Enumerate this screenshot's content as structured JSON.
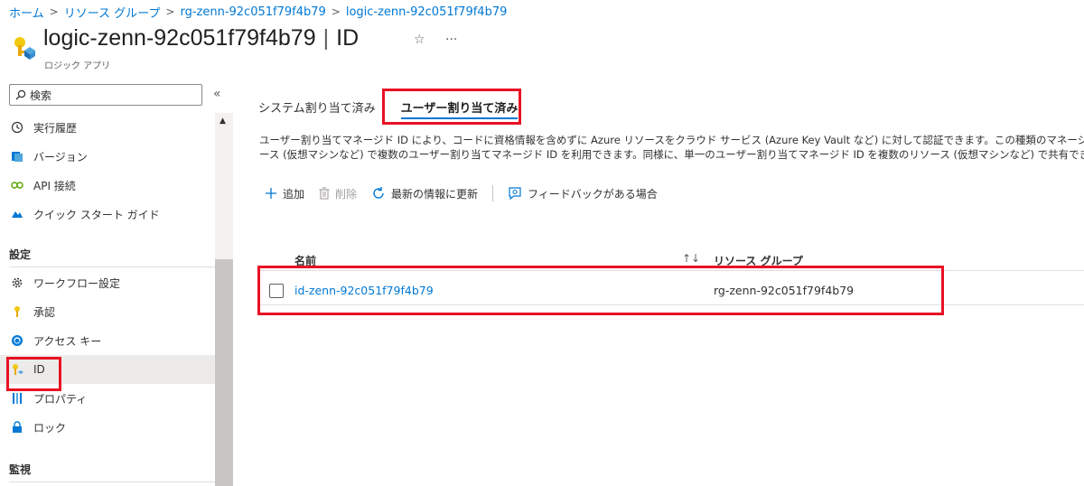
{
  "breadcrumb": [
    {
      "label": "ホーム"
    },
    {
      "label": "リソース グループ"
    },
    {
      "label": "rg-zenn-92c051f79f4b79"
    },
    {
      "label": "logic-zenn-92c051f79f4b79"
    }
  ],
  "breadcrumb_separator": ">",
  "header": {
    "resource_name": "logic-zenn-92c051f79f4b79",
    "separator": "|",
    "page": "ID",
    "resource_type": "ロジック アプリ",
    "favorite_glyph": "☆",
    "more_glyph": "···"
  },
  "sidebar": {
    "search_placeholder": "検索",
    "collapse_glyph": "«",
    "items_top": [
      {
        "label": "実行履歴",
        "icon": "history-icon"
      },
      {
        "label": "バージョン",
        "icon": "versions-icon"
      },
      {
        "label": "API 接続",
        "icon": "api-connection-icon"
      },
      {
        "label": "クイック スタート ガイド",
        "icon": "quickstart-icon"
      }
    ],
    "section_settings": "設定",
    "items_settings": [
      {
        "label": "ワークフロー設定",
        "icon": "gear-icon"
      },
      {
        "label": "承認",
        "icon": "key-icon"
      },
      {
        "label": "アクセス キー",
        "icon": "access-key-icon"
      },
      {
        "label": "ID",
        "icon": "identity-icon",
        "active": true
      },
      {
        "label": "プロパティ",
        "icon": "properties-icon"
      },
      {
        "label": "ロック",
        "icon": "lock-icon"
      }
    ],
    "section_monitoring": "監視",
    "scroll_up_glyph": "▲"
  },
  "tabs": [
    {
      "label": "システム割り当て済み",
      "active": false
    },
    {
      "label": "ユーザー割り当て済み",
      "active": true
    }
  ],
  "description": {
    "line1": "ユーザー割り当てマネージド ID により、コードに資格情報を含めずに Azure リソースをクラウド サービス (Azure Key Vault など) に対して認証できます。この種類のマネージド",
    "line2": "ース (仮想マシンなど) で複数のユーザー割り当てマネージド ID を利用できます。同様に、単一のユーザー割り当てマネージド ID を複数のリソース (仮想マシンなど) で共有でき"
  },
  "toolbar": {
    "add_label": "追加",
    "delete_label": "削除",
    "refresh_label": "最新の情報に更新",
    "feedback_label": "フィードバックがある場合"
  },
  "table": {
    "columns": {
      "name": "名前",
      "sort_glyph": "↑↓",
      "resource_group": "リソース グループ"
    },
    "rows": [
      {
        "name": "id-zenn-92c051f79f4b79",
        "resource_group": "rg-zenn-92c051f79f4b79"
      }
    ]
  },
  "colors": {
    "link": "#0078d4",
    "annotation": "#e81123",
    "active_nav": "#edebe9"
  }
}
